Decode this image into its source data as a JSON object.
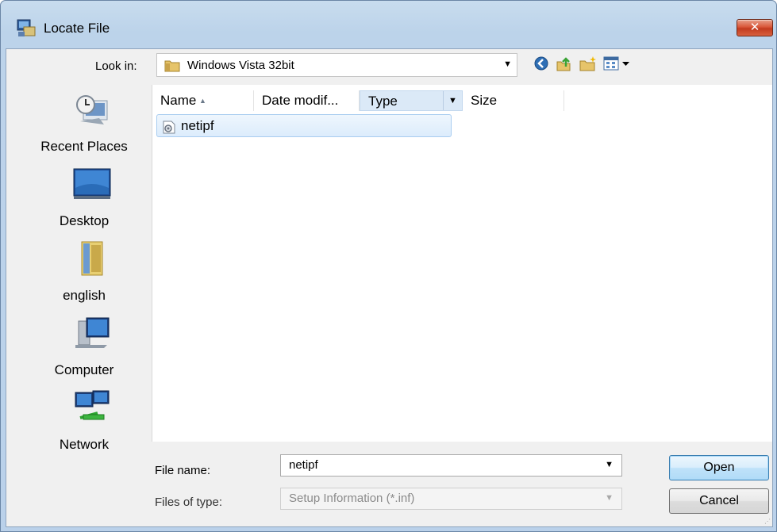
{
  "window": {
    "title": "Locate File",
    "close_label": "✕"
  },
  "toolbar": {
    "look_in_label": "Look in:",
    "look_in_value": "Windows Vista 32bit",
    "icons": [
      "back-icon",
      "up-folder-icon",
      "new-folder-icon",
      "views-menu-icon"
    ]
  },
  "places": [
    {
      "label": "Recent Places",
      "icon": "recent-places-icon"
    },
    {
      "label": "Desktop",
      "icon": "desktop-icon"
    },
    {
      "label": "english",
      "icon": "folder-icon"
    },
    {
      "label": "Computer",
      "icon": "computer-icon"
    },
    {
      "label": "Network",
      "icon": "network-icon"
    }
  ],
  "filelist": {
    "columns": [
      "Name",
      "Date modif...",
      "Type",
      "Size"
    ],
    "sort_column": "Name",
    "rows": [
      {
        "name": "netipf",
        "icon": "setup-info-file-icon",
        "selected": true
      }
    ]
  },
  "form": {
    "file_name_label": "File name:",
    "file_name_value": "netipf",
    "file_type_label": "Files of type:",
    "file_type_value": "Setup Information (*.inf)"
  },
  "buttons": {
    "open": "Open",
    "cancel": "Cancel"
  },
  "colors": {
    "accent": "#3c7fb1",
    "selection": "#dcecfc",
    "close": "#c23b1f"
  }
}
